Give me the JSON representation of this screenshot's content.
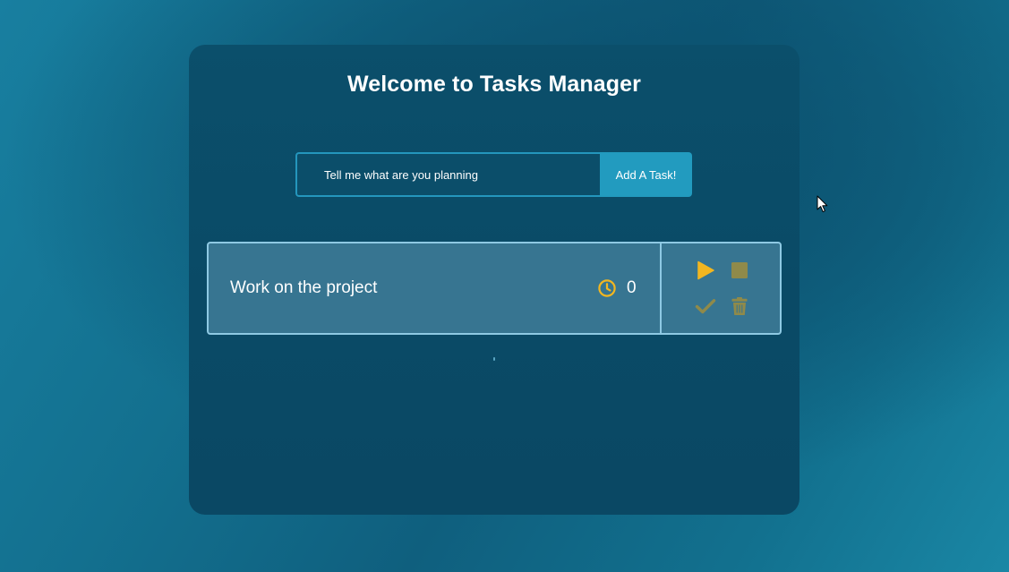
{
  "app": {
    "title": "Welcome to Tasks Manager"
  },
  "task_form": {
    "placeholder": "Tell me what are you planning",
    "value": "",
    "add_button_label": "Add A Task!"
  },
  "tasks": [
    {
      "name": "Work on the project",
      "timer": "0",
      "actions": [
        "play-icon",
        "stop-icon",
        "check-icon",
        "trash-icon"
      ]
    }
  ],
  "colors": {
    "accent": "#229bbf",
    "icon_active": "#f2b620",
    "icon_muted": "#8f8a4a",
    "card_bg": "#377591",
    "card_border": "#8ec9e3",
    "panel_bg": "#0b4f6b"
  }
}
